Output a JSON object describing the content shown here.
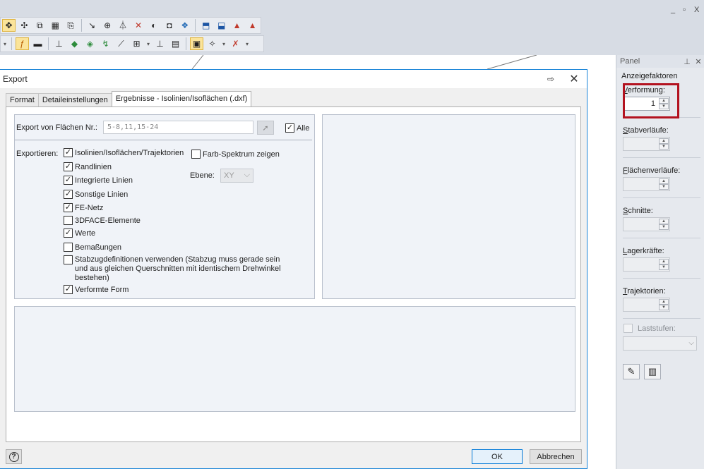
{
  "app": {
    "window_controls": [
      "_",
      "▫",
      "X"
    ],
    "toolbar_row1_icons": [
      "move-icon",
      "rotate-icon",
      "mirror-icon",
      "grid-icon",
      "copy-icon",
      "connect-icon",
      "divide-icon",
      "section-icon",
      "cross-icon",
      "lock-icon",
      "camera-icon",
      "nodes-icon",
      "export-icon",
      "export2-icon",
      "pdf-icon",
      "pdf2-icon"
    ],
    "toolbar_row2_icons": [
      "function-icon",
      "member-icon",
      "support-icon",
      "surface-icon",
      "solid-icon",
      "load-icon",
      "layer-icon",
      "grid2-icon",
      "table-icon",
      "panel-icon",
      "wand-icon",
      "delete-icon"
    ]
  },
  "panel": {
    "title": "Panel",
    "section_title": "Anzeigefaktoren",
    "groups": [
      {
        "label_u": "V",
        "label_rest": "erformung:",
        "value": "1",
        "enabled": true
      },
      {
        "label_u": "S",
        "label_rest": "tabverläufe:",
        "value": "",
        "enabled": false
      },
      {
        "label_u": "F",
        "label_rest": "lächenverläufe:",
        "value": "",
        "enabled": false
      },
      {
        "label_u": "S",
        "label_rest": "chnitte:",
        "value": "",
        "enabled": false
      },
      {
        "label_u": "L",
        "label_rest": "agerkräfte:",
        "value": "",
        "enabled": false
      },
      {
        "label_u": "T",
        "label_rest": "rajektorien:",
        "value": "",
        "enabled": false
      }
    ],
    "laststufen_label": "Laststufen:",
    "buttons": [
      "edit-icon",
      "table-icon"
    ]
  },
  "dialog": {
    "title": "Export",
    "tabs": [
      {
        "label": "Format",
        "active": false
      },
      {
        "label": "Detaileinstellungen",
        "active": false
      },
      {
        "label": "Ergebnisse - Isolinien/Isoflächen (.dxf)",
        "active": true
      }
    ],
    "export_label": "Export von Flächen Nr.:",
    "export_value": "5-8,11,15-24",
    "alle_label": "Alle",
    "alle_checked": true,
    "exportieren_label": "Exportieren:",
    "options": [
      {
        "label": "Isolinien/Isoflächen/Trajektorien",
        "checked": true
      },
      {
        "label": "Randlinien",
        "checked": true
      },
      {
        "label": "Integrierte Linien",
        "checked": true
      },
      {
        "label": "Sonstige Linien",
        "checked": true
      },
      {
        "label": "FE-Netz",
        "checked": true
      },
      {
        "label": "3DFACE-Elemente",
        "checked": false
      },
      {
        "label": "Werte",
        "checked": true
      },
      {
        "label": "Bemaßungen",
        "checked": false
      },
      {
        "label": "Stabzugdefinitionen verwenden (Stabzug muss gerade sein",
        "label2": "und aus gleichen Querschnitten mit identischem Drehwinkel bestehen)",
        "checked": false
      },
      {
        "label": "Verformte Form",
        "checked": true
      }
    ],
    "farb_label": "Farb-Spektrum zeigen",
    "farb_checked": false,
    "ebene_label": "Ebene:",
    "ebene_value": "XY",
    "ok_label": "OK",
    "cancel_label": "Abbrechen",
    "help_label": "?"
  }
}
